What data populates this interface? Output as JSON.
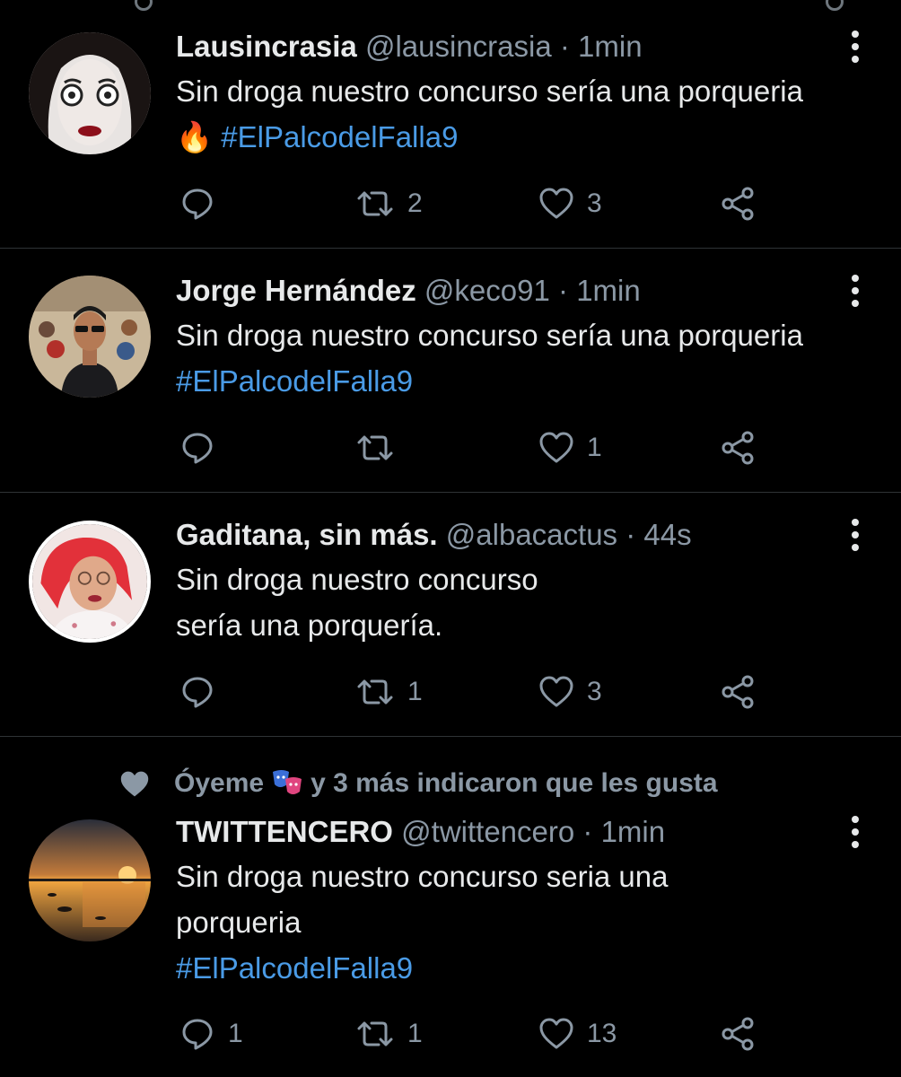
{
  "colors": {
    "background": "#000000",
    "text": "#e7e9ea",
    "muted": "#8b98a5",
    "hashtag": "#4a9be6",
    "divider": "#2f3336"
  },
  "tweets": [
    {
      "name": "Lausincrasia",
      "handle": "@lausincrasia",
      "sep": "·",
      "time": "1min",
      "text": "Sin droga nuestro concurso sería una porqueria",
      "emoji": "🔥",
      "hashtag": "#ElPalcodelFalla9",
      "replies": "",
      "retweets": "2",
      "likes": "3"
    },
    {
      "name": "Jorge Hernández",
      "handle": "@keco91",
      "sep": "·",
      "time": "1min",
      "text": "Sin droga nuestro concurso sería una porqueria",
      "hashtag": "#ElPalcodelFalla9",
      "replies": "",
      "retweets": "",
      "likes": "1"
    },
    {
      "name": "Gaditana, sin más.",
      "handle": "@albacactus",
      "sep": "·",
      "time": "44s",
      "text_line1": "Sin droga nuestro concurso",
      "text_line2": "sería una porquería.",
      "replies": "",
      "retweets": "1",
      "likes": "3"
    },
    {
      "social_context_name": "Óyeme",
      "social_context_rest": "y 3 más indicaron que les gusta",
      "name": "TWITTENCERO",
      "handle": "@twittencero",
      "sep": "·",
      "time": "1min",
      "text_line1": "Sin droga nuestro concurso seria una",
      "text_line2": "porqueria",
      "hashtag": "#ElPalcodelFalla9",
      "replies": "1",
      "retweets": "1",
      "likes": "13"
    }
  ]
}
